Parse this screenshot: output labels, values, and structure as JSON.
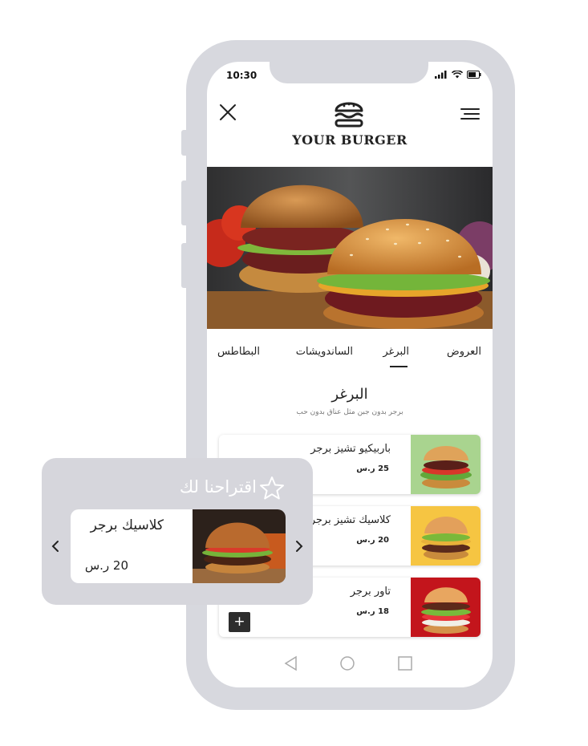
{
  "status": {
    "time": "10:30"
  },
  "header": {
    "brand": "YOUR BURGER"
  },
  "tabs": [
    {
      "label": "العروض"
    },
    {
      "label": "البرغر"
    },
    {
      "label": "الساندويشات"
    },
    {
      "label": "البطاطس"
    }
  ],
  "section": {
    "title": "البرغر",
    "subtitle": "برجر بدون جبن مثل عناق بدون حب"
  },
  "menu_items": [
    {
      "name": "باربيكيو تشيز برجر",
      "price": "25 ر.س"
    },
    {
      "name": "كلاسيك تشيز برجر",
      "price": "20 ر.س"
    },
    {
      "name": "تاور برجر",
      "price": "18 ر.س",
      "add_label": "+"
    }
  ],
  "suggestion": {
    "title": "اقتراحنا لك",
    "item_name": "كلاسيك برجر",
    "item_price": "20 ر.س"
  },
  "colors": {
    "phone_frame": "#d7d8de",
    "suggest_panel": "#d6d6dc",
    "dark_button": "#2d2d2d"
  }
}
